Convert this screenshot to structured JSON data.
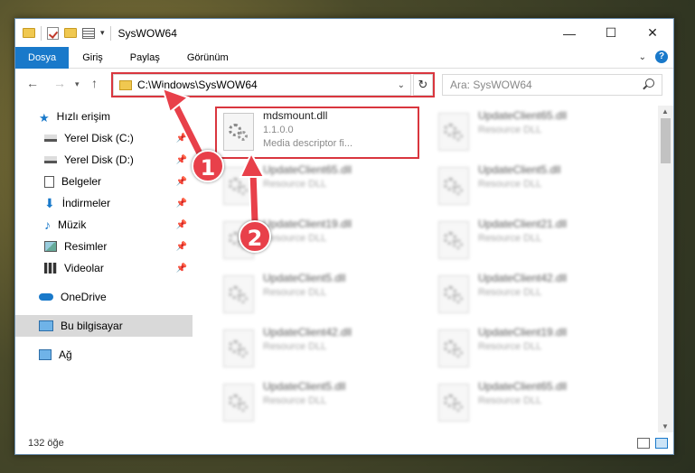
{
  "window": {
    "title": "SysWOW64"
  },
  "ribbon": {
    "tabs": [
      "Dosya",
      "Giriş",
      "Paylaş",
      "Görünüm"
    ],
    "help": "?"
  },
  "address": {
    "path": "C:\\Windows\\SysWOW64"
  },
  "search": {
    "placeholder": "Ara: SysWOW64"
  },
  "sidebar": {
    "items": [
      {
        "label": "Hızlı erişim"
      },
      {
        "label": "Yerel Disk (C:)"
      },
      {
        "label": "Yerel Disk (D:)"
      },
      {
        "label": "Belgeler"
      },
      {
        "label": "İndirmeler"
      },
      {
        "label": "Müzik"
      },
      {
        "label": "Resimler"
      },
      {
        "label": "Videolar"
      },
      {
        "label": "OneDrive"
      },
      {
        "label": "Bu bilgisayar"
      },
      {
        "label": "Ağ"
      }
    ]
  },
  "files": [
    {
      "name": "mdsmount.dll",
      "line1": "1.1.0.0",
      "line2": "Media descriptor fi..."
    },
    {
      "name": "UpdateClient65.dll",
      "line1": "Resource DLL"
    },
    {
      "name": "UpdateClient65.dll",
      "line1": "Resource DLL"
    },
    {
      "name": "UpdateClient5.dll",
      "line1": "Resource DLL"
    },
    {
      "name": "UpdateClient19.dll",
      "line1": "Resource DLL"
    },
    {
      "name": "UpdateClient21.dll",
      "line1": "Resource DLL"
    },
    {
      "name": "UpdateClient5.dll",
      "line1": "Resource DLL"
    },
    {
      "name": "UpdateClient42.dll",
      "line1": "Resource DLL"
    },
    {
      "name": "UpdateClient42.dll",
      "line1": "Resource DLL"
    },
    {
      "name": "UpdateClient19.dll",
      "line1": "Resource DLL"
    },
    {
      "name": "UpdateClient5.dll",
      "line1": "Resource DLL"
    },
    {
      "name": "UpdateClient65.dll",
      "line1": "Resource DLL"
    }
  ],
  "status": {
    "count": "132 öğe"
  },
  "annotations": {
    "step1": "1",
    "step2": "2"
  },
  "colors": {
    "accent": "#1979ca",
    "highlight": "#d9363e"
  }
}
